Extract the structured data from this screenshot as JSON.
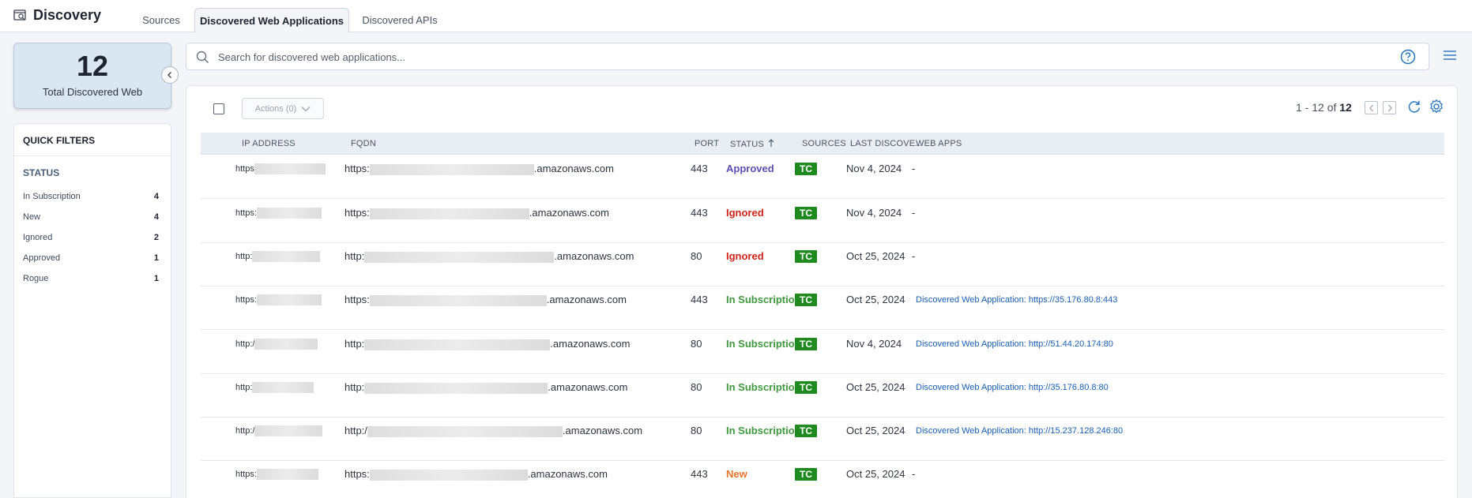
{
  "app": {
    "title": "Discovery"
  },
  "tabs": [
    {
      "label": "Sources",
      "active": false
    },
    {
      "label": "Discovered Web Applications",
      "active": true
    },
    {
      "label": "Discovered APIs",
      "active": false
    }
  ],
  "summary": {
    "count": "12",
    "label": "Total Discovered Web"
  },
  "filters": {
    "title": "QUICK FILTERS",
    "status_title": "STATUS",
    "items": [
      {
        "label": "In Subscription",
        "count": "4"
      },
      {
        "label": "New",
        "count": "4"
      },
      {
        "label": "Ignored",
        "count": "2"
      },
      {
        "label": "Approved",
        "count": "1"
      },
      {
        "label": "Rogue",
        "count": "1"
      }
    ]
  },
  "search": {
    "placeholder": "Search for discovered web applications..."
  },
  "toolbar": {
    "actions_label": "Actions (0)",
    "range": "1 - 12 of",
    "total": "12"
  },
  "table": {
    "columns": [
      "IP ADDRESS",
      "FQDN",
      "PORT",
      "STATUS",
      "SOURCES",
      "LAST DISCOVE...",
      "WEB APPS"
    ],
    "sort_column": "STATUS",
    "rows": [
      {
        "ip": "https",
        "fqdn_prefix": "https:",
        "fqdn_suffix": ".amazonaws.com",
        "port": "443",
        "status": "Approved",
        "source": "TC",
        "last": "Nov 4, 2024",
        "webapp": "-"
      },
      {
        "ip": "https:",
        "fqdn_prefix": "https:",
        "fqdn_suffix": ".amazonaws.com",
        "port": "443",
        "status": "Ignored",
        "source": "TC",
        "last": "Nov 4, 2024",
        "webapp": "-"
      },
      {
        "ip": "http:",
        "fqdn_prefix": "http:",
        "fqdn_suffix": ".amazonaws.com",
        "port": "80",
        "status": "Ignored",
        "source": "TC",
        "last": "Oct 25, 2024",
        "webapp": "-"
      },
      {
        "ip": "https:",
        "fqdn_prefix": "https:",
        "fqdn_suffix": ".amazonaws.com",
        "port": "443",
        "status": "In Subscription",
        "source": "TC",
        "last": "Oct 25, 2024",
        "webapp": "Discovered Web Application: https://35.176.80.8:443"
      },
      {
        "ip": "http:/",
        "fqdn_prefix": "http:",
        "fqdn_suffix": ".amazonaws.com",
        "port": "80",
        "status": "In Subscription",
        "source": "TC",
        "last": "Nov 4, 2024",
        "webapp": "Discovered Web Application: http://51.44.20.174:80"
      },
      {
        "ip": "http:",
        "fqdn_prefix": "http:",
        "fqdn_suffix": ".amazonaws.com",
        "port": "80",
        "status": "In Subscription",
        "source": "TC",
        "last": "Oct 25, 2024",
        "webapp": "Discovered Web Application: http://35.176.80.8:80"
      },
      {
        "ip": "http:/",
        "fqdn_prefix": "http:/",
        "fqdn_suffix": ".amazonaws.com",
        "port": "80",
        "status": "In Subscription",
        "source": "TC",
        "last": "Oct 25, 2024",
        "webapp": "Discovered Web Application: http://15.237.128.246:80"
      },
      {
        "ip": "https:",
        "fqdn_prefix": "https:",
        "fqdn_suffix": ".amazonaws.com",
        "port": "443",
        "status": "New",
        "source": "TC",
        "last": "Oct 25, 2024",
        "webapp": "-"
      }
    ]
  },
  "colors": {
    "Approved": "#5b4fb0",
    "Ignored": "#d0241b",
    "In Subscription": "#3f9a3f",
    "New": "#e8742a"
  }
}
